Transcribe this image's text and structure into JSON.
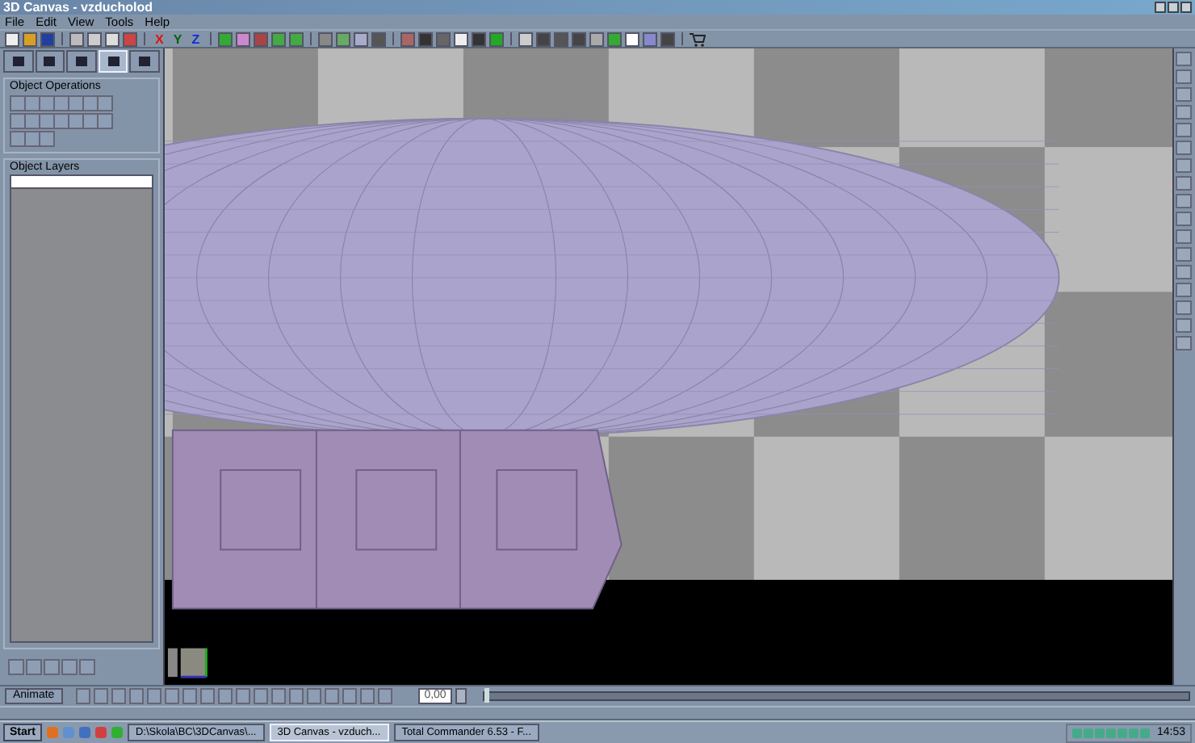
{
  "window": {
    "title": "3D Canvas - vzducholod"
  },
  "menu": [
    "File",
    "Edit",
    "View",
    "Tools",
    "Help"
  ],
  "axis_buttons": [
    {
      "label": "X",
      "color": "#e01010"
    },
    {
      "label": "Y",
      "color": "#006400"
    },
    {
      "label": "Z",
      "color": "#1030d0"
    }
  ],
  "panel_tabs": [
    {
      "selected": false
    },
    {
      "selected": false
    },
    {
      "selected": false
    },
    {
      "selected": true
    },
    {
      "selected": false
    }
  ],
  "object_operations": {
    "title": "Object Operations"
  },
  "object_layers": {
    "title": "Object Layers"
  },
  "animation_bar": {
    "button": "Animate",
    "time_value": "0,00",
    "timeline": {
      "level": 0
    }
  },
  "taskbar": {
    "start": "Start",
    "tasks": [
      {
        "label": "D:\\Skola\\BC\\3DCanvas\\...",
        "selected": false
      },
      {
        "label": "3D Canvas - vzduch...",
        "selected": true
      },
      {
        "label": "Total Commander 6.53 - F...",
        "selected": false
      }
    ],
    "clock": "14:53"
  }
}
